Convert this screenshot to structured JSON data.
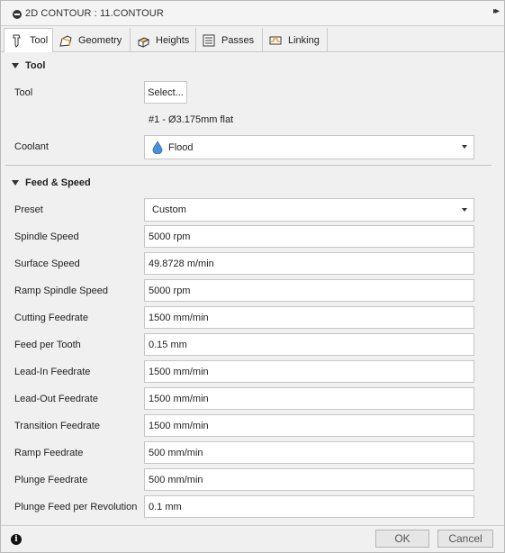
{
  "titlebar": {
    "title": "2D CONTOUR : 11.CONTOUR",
    "expand_glyph": "▸▸"
  },
  "tabs": [
    {
      "label": "Tool",
      "icon": "tool-icon",
      "active": true
    },
    {
      "label": "Geometry",
      "icon": "geometry-icon",
      "active": false
    },
    {
      "label": "Heights",
      "icon": "heights-icon",
      "active": false
    },
    {
      "label": "Passes",
      "icon": "passes-icon",
      "active": false
    },
    {
      "label": "Linking",
      "icon": "linking-icon",
      "active": false
    }
  ],
  "tool_section": {
    "heading": "Tool",
    "tool_label": "Tool",
    "select_button": "Select...",
    "tool_description": "#1 - Ø3.175mm flat",
    "coolant_label": "Coolant",
    "coolant_value": "Flood",
    "coolant_icon": "water-drop-icon"
  },
  "feed_section": {
    "heading": "Feed & Speed",
    "preset_label": "Preset",
    "preset_value": "Custom",
    "rows": [
      {
        "label": "Spindle Speed",
        "value": "5000 rpm"
      },
      {
        "label": "Surface Speed",
        "value": "49.8728 m/min"
      },
      {
        "label": "Ramp Spindle Speed",
        "value": "5000 rpm"
      },
      {
        "label": "Cutting Feedrate",
        "value": "1500 mm/min"
      },
      {
        "label": "Feed per Tooth",
        "value": "0.15 mm"
      },
      {
        "label": "Lead-In Feedrate",
        "value": "1500 mm/min"
      },
      {
        "label": "Lead-Out Feedrate",
        "value": "1500 mm/min"
      },
      {
        "label": "Transition Feedrate",
        "value": "1500 mm/min"
      },
      {
        "label": "Ramp Feedrate",
        "value": "500 mm/min"
      },
      {
        "label": "Plunge Feedrate",
        "value": "500 mm/min"
      },
      {
        "label": "Plunge Feed per Revolution",
        "value": "0.1 mm"
      }
    ]
  },
  "footer": {
    "info_glyph": "i",
    "ok_label": "OK",
    "cancel_label": "Cancel"
  },
  "colors": {
    "drop_blue": "#4a90d9",
    "panel_bg": "#f0f0f0"
  }
}
